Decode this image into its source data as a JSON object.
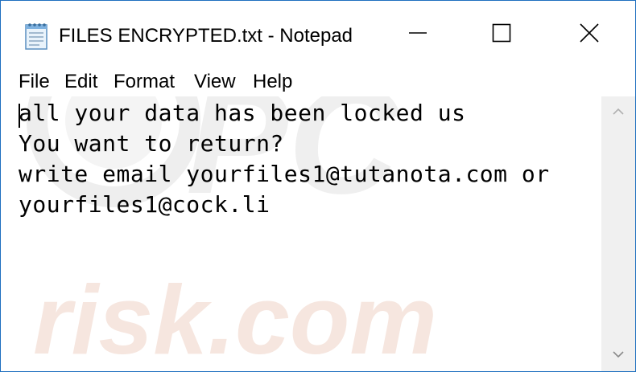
{
  "window": {
    "title": "FILES ENCRYPTED.txt - Notepad"
  },
  "menu": {
    "items": [
      "File",
      "Edit",
      "Format",
      "View",
      "Help"
    ]
  },
  "document": {
    "lines": [
      "all your data has been locked us",
      "You want to return?",
      "write email yourfiles1@tutanota.com or",
      "yourfiles1@cock.li"
    ]
  },
  "watermark": {
    "logo_text": "PC",
    "text": "risk.com"
  },
  "icons": {
    "app": "notepad-icon",
    "minimize": "minimize-icon",
    "maximize": "maximize-icon",
    "close": "close-icon",
    "scroll_up": "scroll-up-arrow-icon",
    "scroll_down": "scroll-down-arrow-icon"
  },
  "colors": {
    "window_border": "#1e6fbf",
    "watermark": "#e8e8e8",
    "watermark_accent": "#f7e4dc"
  }
}
